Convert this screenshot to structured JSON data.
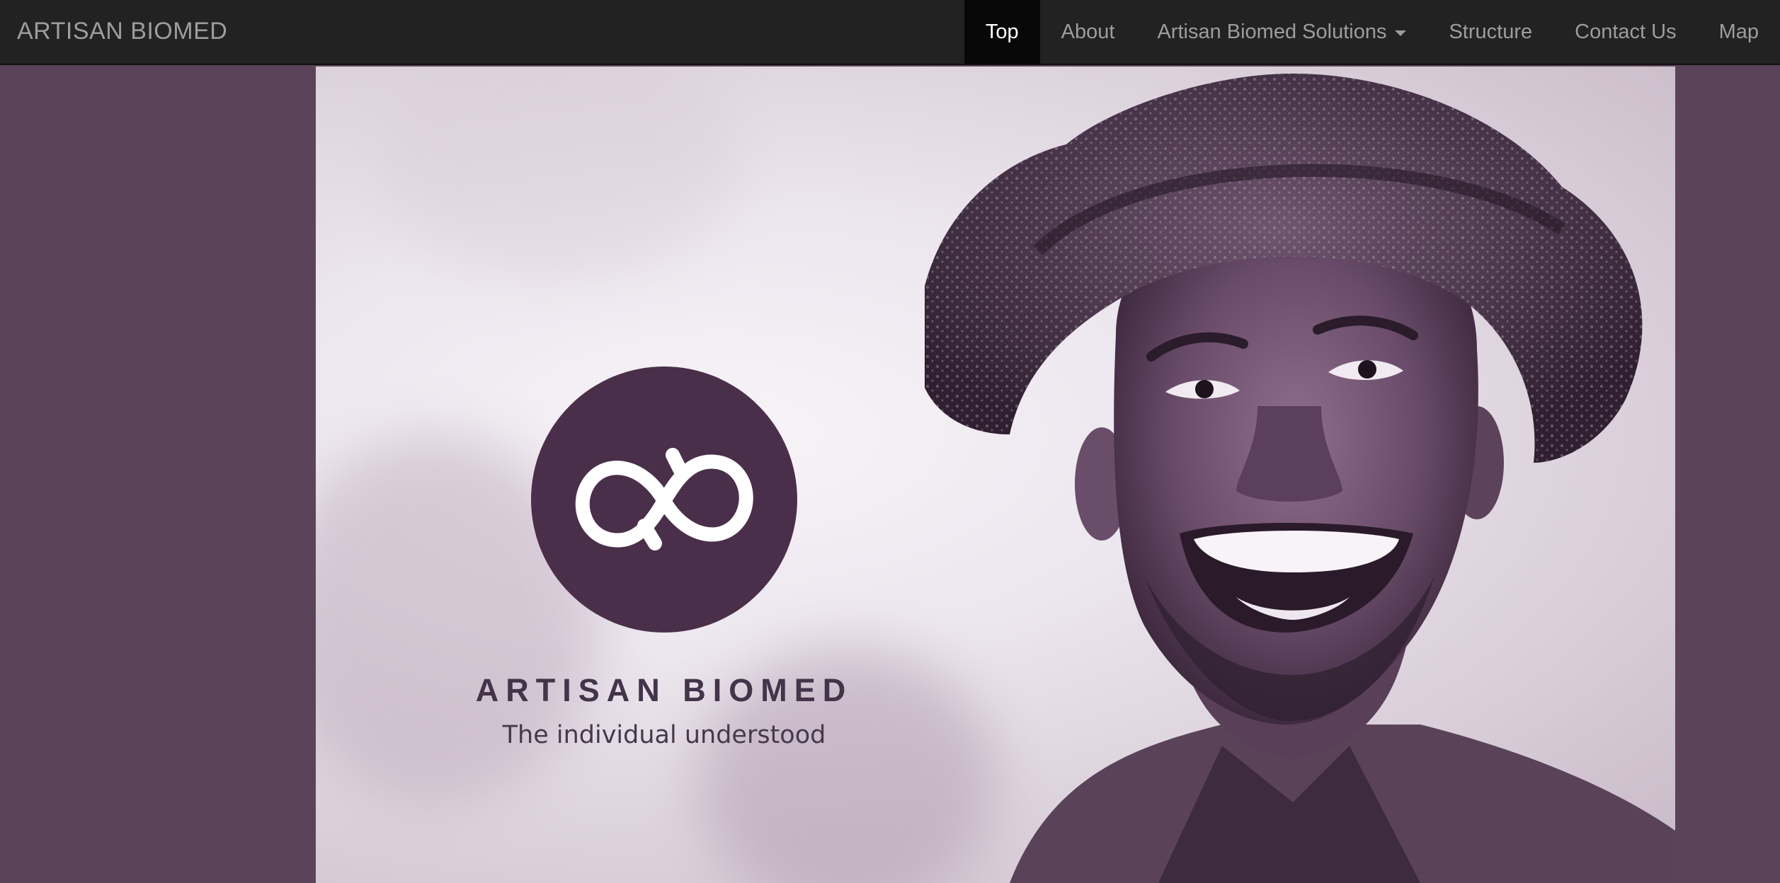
{
  "navbar": {
    "brand": "ARTISAN BIOMED",
    "items": [
      {
        "label": "Top",
        "active": true
      },
      {
        "label": "About",
        "active": false
      },
      {
        "label": "Artisan Biomed Solutions",
        "active": false,
        "dropdown": true
      },
      {
        "label": "Structure",
        "active": false
      },
      {
        "label": "Contact Us",
        "active": false
      },
      {
        "label": "Map",
        "active": false
      }
    ]
  },
  "hero": {
    "logo_icon": "infinity-icon",
    "title": "ARTISAN BIOMED",
    "tagline": "The individual understood"
  },
  "colors": {
    "navbar_bg": "#222222",
    "nav_active_bg": "#080808",
    "page_bg": "#5b4459",
    "logo_purple": "#4a2f4a"
  }
}
